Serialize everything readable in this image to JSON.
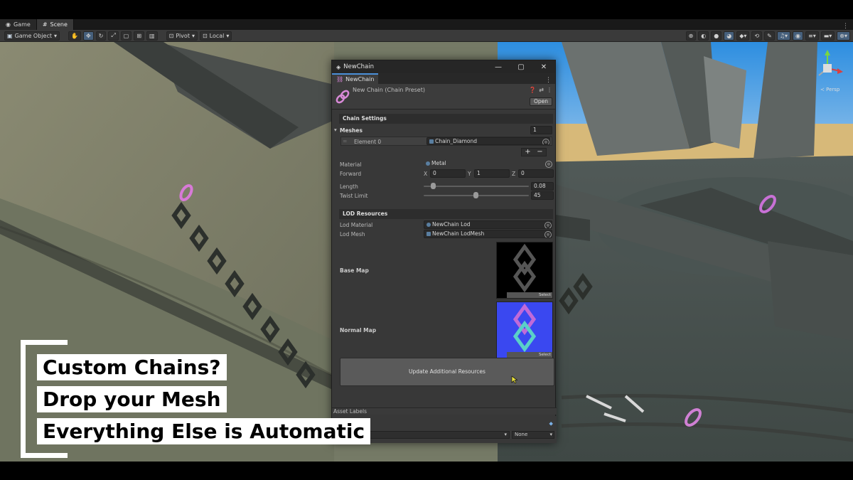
{
  "tabs": [
    {
      "label": "Game",
      "icon": "gamepad-icon"
    },
    {
      "label": "Scene",
      "icon": "grid-icon"
    }
  ],
  "toolbar": {
    "object_mode": "Game Object",
    "pivot": "Pivot",
    "space": "Local"
  },
  "window": {
    "title": "NewChain",
    "tab_label": "NewChain",
    "asset_name": "New Chain (Chain Preset)",
    "open_label": "Open",
    "chain_settings": {
      "header": "Chain Settings",
      "meshes_label": "Meshes",
      "meshes_count": "1",
      "element_label": "Element 0",
      "element_value": "Chain_Diamond",
      "material_label": "Material",
      "material_value": "Metal",
      "forward_label": "Forward",
      "forward": {
        "x": "0",
        "y": "1",
        "z": "0"
      },
      "length_label": "Length",
      "length_value": "0.08",
      "twist_label": "Twist Limit",
      "twist_value": "45"
    },
    "lod": {
      "header": "LOD Resources",
      "material_label": "Lod Material",
      "material_value": "NewChain Lod",
      "mesh_label": "Lod Mesh",
      "mesh_value": "NewChain LodMesh",
      "base_map_label": "Base Map",
      "normal_map_label": "Normal Map",
      "select_label": "Select"
    },
    "update_button": "Update Additional Resources",
    "asset_labels": "Asset Labels",
    "bundle_value": "None"
  },
  "gizmo": {
    "persp_label": "Persp"
  },
  "captions": [
    "Custom Chains?",
    "Drop your Mesh",
    "Everything Else is Automatic"
  ]
}
